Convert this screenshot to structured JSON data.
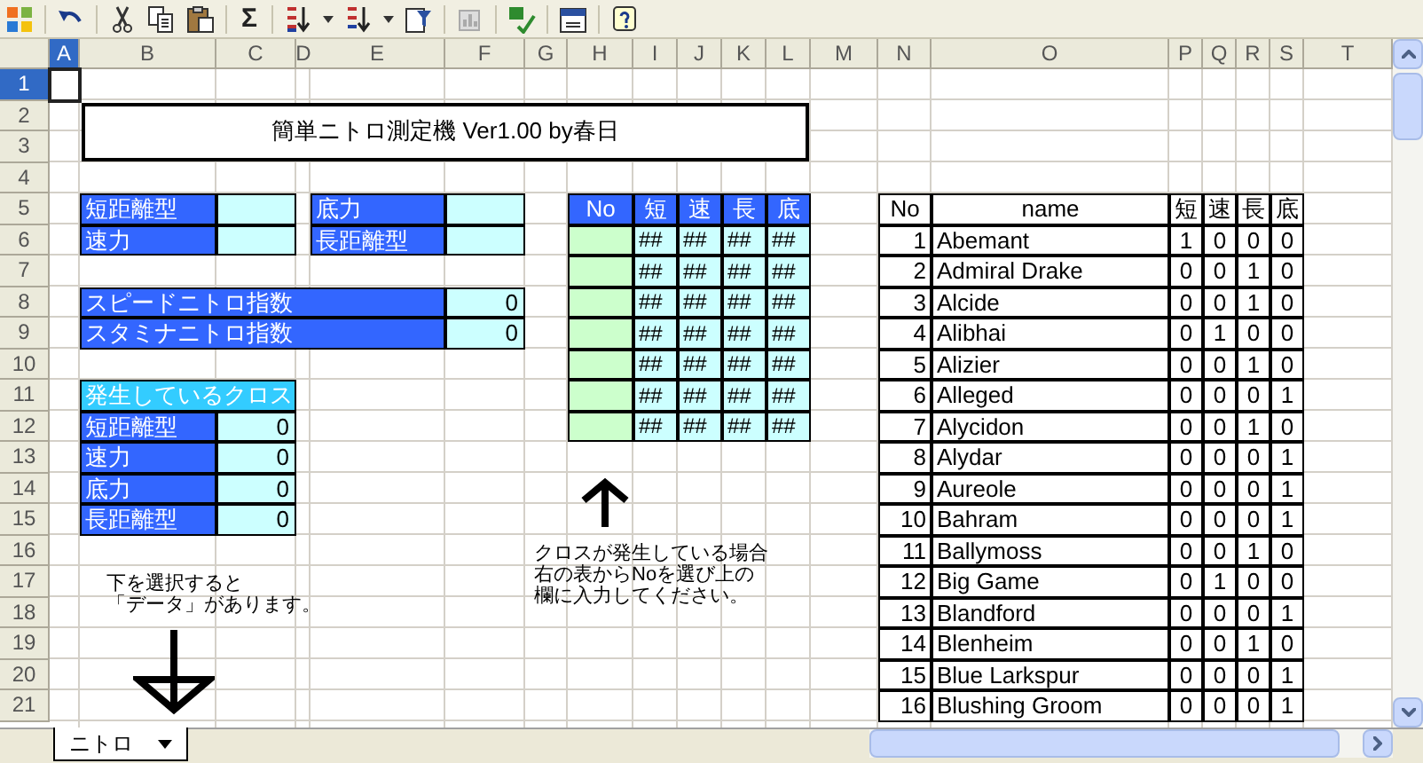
{
  "toolbar": {
    "sum_glyph": "Σ"
  },
  "column_headers": [
    {
      "label": "A",
      "selected": true
    },
    {
      "label": "B",
      "selected": false
    },
    {
      "label": "C",
      "selected": false
    },
    {
      "label": "D",
      "selected": false
    },
    {
      "label": "E",
      "selected": false
    },
    {
      "label": "F",
      "selected": false
    },
    {
      "label": "G",
      "selected": false
    },
    {
      "label": "H",
      "selected": false
    },
    {
      "label": "I",
      "selected": false
    },
    {
      "label": "J",
      "selected": false
    },
    {
      "label": "K",
      "selected": false
    },
    {
      "label": "L",
      "selected": false
    },
    {
      "label": "M",
      "selected": false
    },
    {
      "label": "N",
      "selected": false
    },
    {
      "label": "O",
      "selected": false
    },
    {
      "label": "P",
      "selected": false
    },
    {
      "label": "Q",
      "selected": false
    },
    {
      "label": "R",
      "selected": false
    },
    {
      "label": "S",
      "selected": false
    },
    {
      "label": "T",
      "selected": false
    }
  ],
  "row_headers": [
    {
      "label": "1",
      "selected": true
    },
    {
      "label": "2",
      "selected": false
    },
    {
      "label": "3",
      "selected": false
    },
    {
      "label": "4",
      "selected": false
    },
    {
      "label": "5",
      "selected": false
    },
    {
      "label": "6",
      "selected": false
    },
    {
      "label": "7",
      "selected": false
    },
    {
      "label": "8",
      "selected": false
    },
    {
      "label": "9",
      "selected": false
    },
    {
      "label": "10",
      "selected": false
    },
    {
      "label": "11",
      "selected": false
    },
    {
      "label": "12",
      "selected": false
    },
    {
      "label": "13",
      "selected": false
    },
    {
      "label": "14",
      "selected": false
    },
    {
      "label": "15",
      "selected": false
    },
    {
      "label": "16",
      "selected": false
    },
    {
      "label": "17",
      "selected": false
    },
    {
      "label": "18",
      "selected": false
    },
    {
      "label": "19",
      "selected": false
    },
    {
      "label": "20",
      "selected": false
    },
    {
      "label": "21",
      "selected": false
    }
  ],
  "title": "簡単ニトロ測定機 Ver1.00 by春日",
  "inputs": [
    {
      "label": "短距離型"
    },
    {
      "label": "底力"
    },
    {
      "label": "速力"
    },
    {
      "label": "長距離型"
    }
  ],
  "indices": [
    {
      "label": "スピードニトロ指数",
      "value": "0"
    },
    {
      "label": "スタミナニトロ指数",
      "value": "0"
    }
  ],
  "cross": {
    "header": "発生しているクロス",
    "rows": [
      {
        "label": "短距離型",
        "value": "0"
      },
      {
        "label": "速力",
        "value": "0"
      },
      {
        "label": "底力",
        "value": "0"
      },
      {
        "label": "長距離型",
        "value": "0"
      }
    ]
  },
  "pick_table": {
    "columns": [
      "No",
      "短",
      "速",
      "長",
      "底"
    ],
    "rows": [
      [
        "",
        "##",
        "##",
        "##",
        "##"
      ],
      [
        "",
        "##",
        "##",
        "##",
        "##"
      ],
      [
        "",
        "##",
        "##",
        "##",
        "##"
      ],
      [
        "",
        "##",
        "##",
        "##",
        "##"
      ],
      [
        "",
        "##",
        "##",
        "##",
        "##"
      ],
      [
        "",
        "##",
        "##",
        "##",
        "##"
      ],
      [
        "",
        "##",
        "##",
        "##",
        "##"
      ]
    ]
  },
  "note_right": [
    "クロスが発生している場合",
    "右の表からNoを選び上の",
    "欄に入力してください。"
  ],
  "note_left": [
    "下を選択すると",
    "「データ」があります。"
  ],
  "horse_table": {
    "columns": [
      "No",
      "name",
      "短",
      "速",
      "長",
      "底"
    ],
    "rows": [
      [
        "1",
        "Abemant",
        "1",
        "0",
        "0",
        "0"
      ],
      [
        "2",
        "Admiral Drake",
        "0",
        "0",
        "1",
        "0"
      ],
      [
        "3",
        "Alcide",
        "0",
        "0",
        "1",
        "0"
      ],
      [
        "4",
        "Alibhai",
        "0",
        "1",
        "0",
        "0"
      ],
      [
        "5",
        "Alizier",
        "0",
        "0",
        "1",
        "0"
      ],
      [
        "6",
        "Alleged",
        "0",
        "0",
        "0",
        "1"
      ],
      [
        "7",
        "Alycidon",
        "0",
        "0",
        "1",
        "0"
      ],
      [
        "8",
        "Alydar",
        "0",
        "0",
        "0",
        "1"
      ],
      [
        "9",
        "Aureole",
        "0",
        "0",
        "0",
        "1"
      ],
      [
        "10",
        "Bahram",
        "0",
        "0",
        "0",
        "1"
      ],
      [
        "11",
        "Ballymoss",
        "0",
        "0",
        "1",
        "0"
      ],
      [
        "12",
        "Big Game",
        "0",
        "1",
        "0",
        "0"
      ],
      [
        "13",
        "Blandford",
        "0",
        "0",
        "0",
        "1"
      ],
      [
        "14",
        "Blenheim",
        "0",
        "0",
        "1",
        "0"
      ],
      [
        "15",
        "Blue Larkspur",
        "0",
        "0",
        "0",
        "1"
      ],
      [
        "16",
        "Blushing Groom",
        "0",
        "0",
        "0",
        "1"
      ]
    ]
  },
  "sheet_tabs": [
    {
      "label": "ニトロ",
      "selected": true
    }
  ]
}
